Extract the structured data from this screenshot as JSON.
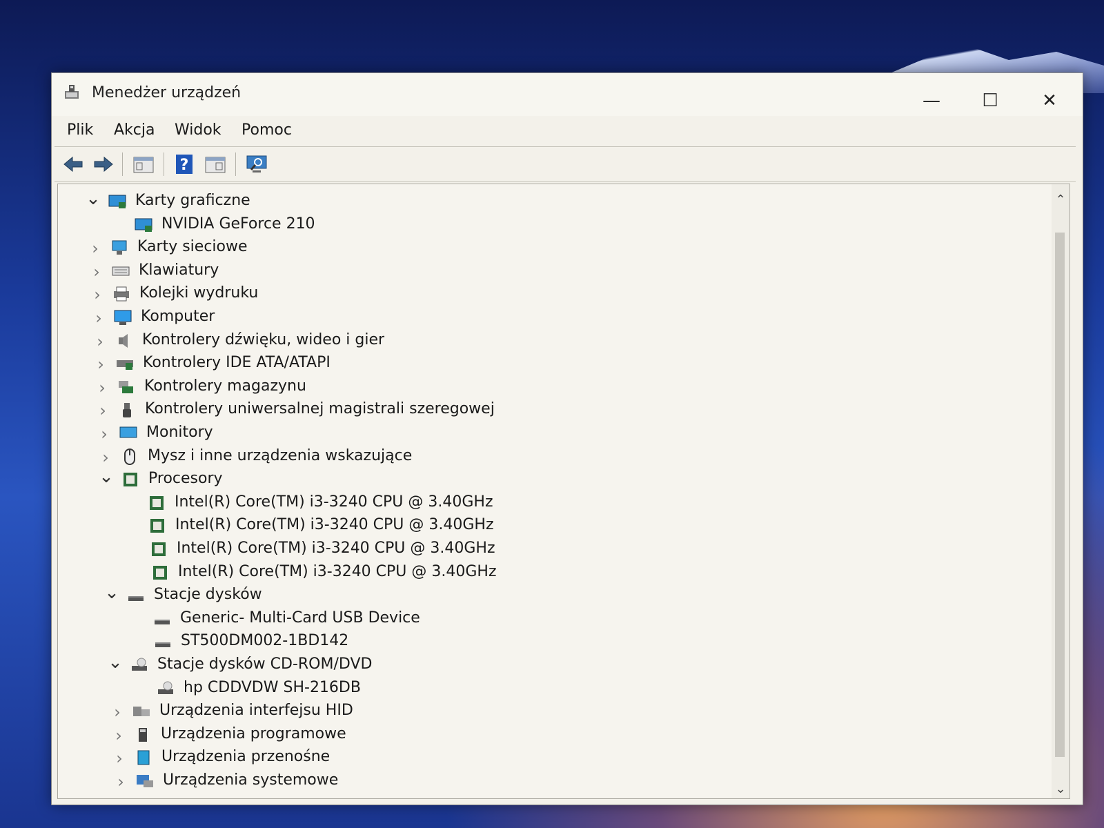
{
  "window": {
    "title": "Menedżer urządzeń",
    "controls": {
      "minimize": "—",
      "maximize": "☐",
      "close": "✕"
    }
  },
  "menu": [
    "Plik",
    "Akcja",
    "Widok",
    "Pomoc"
  ],
  "toolbar": [
    {
      "name": "back-button",
      "icon": "arrow-left-icon"
    },
    {
      "name": "forward-button",
      "icon": "arrow-right-icon"
    },
    {
      "name": "properties-button",
      "icon": "properties-icon"
    },
    {
      "name": "help-button",
      "icon": "help-icon"
    },
    {
      "name": "view-button",
      "icon": "view-icon"
    },
    {
      "name": "scan-hardware-button",
      "icon": "monitor-scan-icon"
    }
  ],
  "tree": [
    {
      "label": "Karty graficzne",
      "level": 0,
      "expanded": true,
      "icon": "display-adapter-icon"
    },
    {
      "label": "NVIDIA GeForce 210",
      "level": 1,
      "icon": "display-adapter-icon"
    },
    {
      "label": "Karty sieciowe",
      "level": 0,
      "expanded": false,
      "icon": "network-icon"
    },
    {
      "label": "Klawiatury",
      "level": 0,
      "expanded": false,
      "icon": "keyboard-icon"
    },
    {
      "label": "Kolejki wydruku",
      "level": 0,
      "expanded": false,
      "icon": "printer-icon"
    },
    {
      "label": "Komputer",
      "level": 0,
      "expanded": false,
      "icon": "computer-icon"
    },
    {
      "label": "Kontrolery dźwięku, wideo i gier",
      "level": 0,
      "expanded": false,
      "icon": "speaker-icon"
    },
    {
      "label": "Kontrolery IDE ATA/ATAPI",
      "level": 0,
      "expanded": false,
      "icon": "ide-controller-icon"
    },
    {
      "label": "Kontrolery magazynu",
      "level": 0,
      "expanded": false,
      "icon": "storage-controller-icon"
    },
    {
      "label": "Kontrolery uniwersalnej magistrali szeregowej",
      "level": 0,
      "expanded": false,
      "icon": "usb-icon"
    },
    {
      "label": "Monitory",
      "level": 0,
      "expanded": false,
      "icon": "monitor-icon"
    },
    {
      "label": "Mysz i inne urządzenia wskazujące",
      "level": 0,
      "expanded": false,
      "icon": "mouse-icon"
    },
    {
      "label": "Procesory",
      "level": 0,
      "expanded": true,
      "icon": "processor-icon"
    },
    {
      "label": "Intel(R) Core(TM) i3-3240 CPU @ 3.40GHz",
      "level": 1,
      "icon": "processor-icon"
    },
    {
      "label": "Intel(R) Core(TM) i3-3240 CPU @ 3.40GHz",
      "level": 1,
      "icon": "processor-icon"
    },
    {
      "label": "Intel(R) Core(TM) i3-3240 CPU @ 3.40GHz",
      "level": 1,
      "icon": "processor-icon"
    },
    {
      "label": "Intel(R) Core(TM) i3-3240 CPU @ 3.40GHz",
      "level": 1,
      "icon": "processor-icon"
    },
    {
      "label": "Stacje dysków",
      "level": 0,
      "expanded": true,
      "icon": "disk-drive-icon"
    },
    {
      "label": "Generic- Multi-Card USB Device",
      "level": 1,
      "icon": "disk-drive-icon"
    },
    {
      "label": "ST500DM002-1BD142",
      "level": 1,
      "icon": "disk-drive-icon"
    },
    {
      "label": "Stacje dysków CD-ROM/DVD",
      "level": 0,
      "expanded": true,
      "icon": "cd-drive-icon"
    },
    {
      "label": "hp CDDVDW SH-216DB",
      "level": 1,
      "icon": "cd-drive-icon"
    },
    {
      "label": "Urządzenia interfejsu HID",
      "level": 0,
      "expanded": false,
      "icon": "hid-icon"
    },
    {
      "label": "Urządzenia programowe",
      "level": 0,
      "expanded": false,
      "icon": "software-device-icon"
    },
    {
      "label": "Urządzenia przenośne",
      "level": 0,
      "expanded": false,
      "icon": "portable-device-icon"
    },
    {
      "label": "Urządzenia systemowe",
      "level": 0,
      "expanded": false,
      "icon": "system-device-icon"
    }
  ],
  "scrollbar": {
    "up": "⌃",
    "down": "⌄"
  }
}
